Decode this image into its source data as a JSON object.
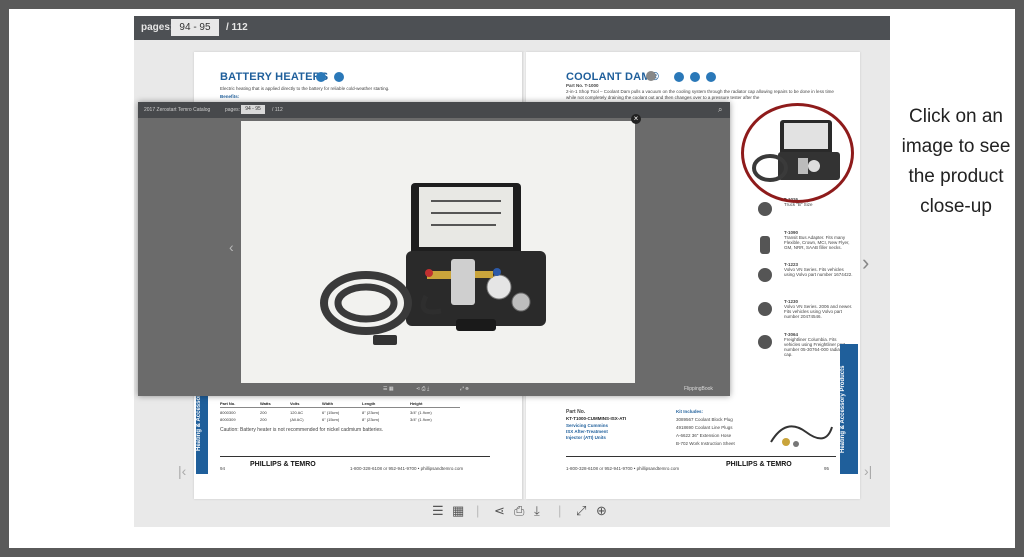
{
  "viewer": {
    "pages_label": "pages:",
    "pages_value": "94 - 95",
    "pages_total": "/ 112"
  },
  "left_page": {
    "title": "BATTERY HEATERS",
    "intro": "Electric heating that is applied directly to the battery for reliable cold-weather starting.",
    "benefits": "Benefits:",
    "table_headers": [
      "Part No.",
      "Watts",
      "Volts",
      "Width",
      "Length",
      "Height"
    ],
    "table_rows": [
      [
        "8000300",
        "200",
        "120 AC",
        "6\" (15cm)",
        "8\" (23cm)",
        "3/4\" (1.9cm)"
      ],
      [
        "8000309",
        "200",
        "(All AC)",
        "6\" (15cm)",
        "8\" (23cm)",
        "3/4\" (1.9cm)"
      ]
    ],
    "caution": "Caution: Battery heater is not recommended for nickel cadmium batteries.",
    "side_tab": "Heating & Accessories",
    "page_number": "94",
    "contact": "1-800-328-6108 or 952-941-9700 • phillipsandtemro.com",
    "brand": "PHILLIPS & TEMRO"
  },
  "right_page": {
    "title": "COOLANT DAM®",
    "part": "Part No. T-1000",
    "desc": "2-in-1 Shop Tool – Coolant Dam pulls a vacuum on the cooling system through the radiator cap allowing repairs to be done in less time while not completely draining the coolant out and then changes over to a pressure tester after the",
    "items": [
      {
        "code": "T-1026",
        "text": "Truck \"B\" Size"
      },
      {
        "code": "T-1090",
        "text": "Transit Bus Adapter. Fits many Flexible, Crown, MCI, New Flyer, GM, NRR, SAAB filler necks."
      },
      {
        "code": "T-1223",
        "text": "Volvo VN Series. Fits vehicles using Volvo part number 1674422."
      },
      {
        "code": "T-1230",
        "text": "Volvo VN Series. 2006 and newer. Fits vehicles using Volvo part number 20474546."
      },
      {
        "code": "T-3064",
        "text": "Freightliner Columbia. Fits vehicles using Freightliner part number 05-30764-000 radiator cap."
      }
    ],
    "kit_part": "Part No.",
    "kit_code": "KT-T1000-CUMMINS-ISX-ATI",
    "kit_lines": [
      "Servicing Cummins",
      "ISX After-Treatment",
      "Injector (ATI) Units"
    ],
    "kit_includes": "Kit Includes:",
    "kit_items": [
      "3089567 Coolant Block Plug",
      "4918690 Coolant Line Plugs",
      "A-6622 36\" Extension Hose",
      "B-702 Work Instruction Sheet"
    ],
    "side_tab": "Heating & Accessory Products",
    "page_number": "95",
    "contact": "1-800-328-6108 or 952-941-9700 • phillipsandtemro.com",
    "brand": "PHILLIPS & TEMRO"
  },
  "modal": {
    "catalog_title": "2017 Zerostart Temro Catalog",
    "pages_label": "pages:",
    "pages_value": "94 - 95",
    "pages_total": "/ 112",
    "brand_footer": "FlippingBook"
  },
  "callout": {
    "line1": "Click on an",
    "line2": "image to see",
    "line3": "the product",
    "line4": "close-up"
  },
  "colors": {
    "brand_blue": "#1f5f9b",
    "highlight_red": "#8e1b1b",
    "toolbar": "#4d5054"
  }
}
